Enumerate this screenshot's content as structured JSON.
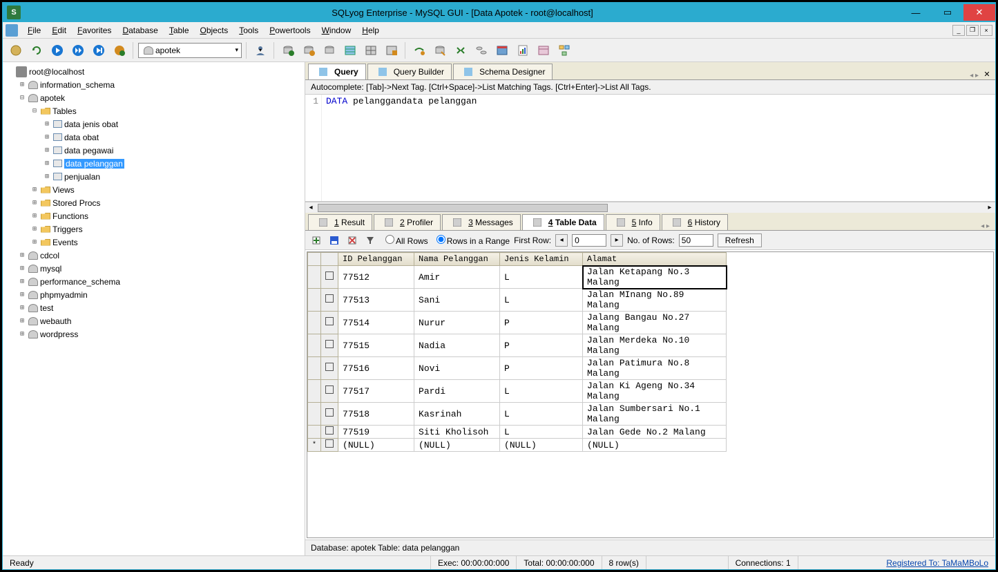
{
  "title": "SQLyog Enterprise - MySQL GUI - [Data Apotek - root@localhost]",
  "menubar": [
    "File",
    "Edit",
    "Favorites",
    "Database",
    "Table",
    "Objects",
    "Tools",
    "Powertools",
    "Window",
    "Help"
  ],
  "db_selected": "apotek",
  "tree": {
    "root": "root@localhost",
    "dbs": [
      {
        "name": "information_schema",
        "expanded": false
      },
      {
        "name": "apotek",
        "expanded": true,
        "children": [
          {
            "name": "Tables",
            "type": "folder",
            "expanded": true,
            "children": [
              {
                "name": "data jenis obat",
                "type": "table"
              },
              {
                "name": "data obat",
                "type": "table"
              },
              {
                "name": "data pegawai",
                "type": "table"
              },
              {
                "name": "data pelanggan",
                "type": "table",
                "selected": true
              },
              {
                "name": "penjualan",
                "type": "table"
              }
            ]
          },
          {
            "name": "Views",
            "type": "folder"
          },
          {
            "name": "Stored Procs",
            "type": "folder"
          },
          {
            "name": "Functions",
            "type": "folder"
          },
          {
            "name": "Triggers",
            "type": "folder"
          },
          {
            "name": "Events",
            "type": "folder"
          }
        ]
      },
      {
        "name": "cdcol"
      },
      {
        "name": "mysql"
      },
      {
        "name": "performance_schema"
      },
      {
        "name": "phpmyadmin"
      },
      {
        "name": "test"
      },
      {
        "name": "webauth"
      },
      {
        "name": "wordpress"
      }
    ]
  },
  "query_tabs": [
    {
      "label": "Query",
      "active": true
    },
    {
      "label": "Query Builder"
    },
    {
      "label": "Schema Designer"
    }
  ],
  "autocomplete_hint": "Autocomplete: [Tab]->Next Tag. [Ctrl+Space]->List Matching Tags. [Ctrl+Enter]->List All Tags.",
  "query": {
    "line": "1",
    "kw": "DATA",
    "rest": " pelanggandata pelanggan"
  },
  "result_tabs": [
    {
      "n": "1",
      "label": "Result"
    },
    {
      "n": "2",
      "label": "Profiler"
    },
    {
      "n": "3",
      "label": "Messages"
    },
    {
      "n": "4",
      "label": "Table Data",
      "active": true
    },
    {
      "n": "5",
      "label": "Info"
    },
    {
      "n": "6",
      "label": "History"
    }
  ],
  "td_toolbar": {
    "allrows": "All Rows",
    "range": "Rows in a Range",
    "firstrow_lbl": "First Row:",
    "firstrow": "0",
    "numrows_lbl": "No. of Rows:",
    "numrows": "50",
    "refresh": "Refresh"
  },
  "columns": [
    "ID Pelanggan",
    "Nama Pelanggan",
    "Jenis Kelamin",
    "Alamat"
  ],
  "rows": [
    [
      "77512",
      "Amir",
      "L",
      "Jalan Ketapang No.3 Malang"
    ],
    [
      "77513",
      "Sani",
      "L",
      "Jalan MInang No.89 Malang"
    ],
    [
      "77514",
      "Nurur",
      "P",
      "Jalang Bangau No.27 Malang"
    ],
    [
      "77515",
      "Nadia",
      "P",
      "Jalan Merdeka No.10 Malang"
    ],
    [
      "77516",
      "Novi",
      "P",
      "Jalan Patimura No.8 Malang"
    ],
    [
      "77517",
      "Pardi",
      "L",
      "Jalan Ki Ageng No.34 Malang"
    ],
    [
      "77518",
      "Kasrinah",
      "L",
      "Jalan Sumbersari No.1 Malang"
    ],
    [
      "77519",
      "Siti Kholisoh",
      "L",
      "Jalan Gede No.2 Malang"
    ]
  ],
  "null_row": [
    "(NULL)",
    "(NULL)",
    "(NULL)",
    "(NULL)"
  ],
  "selected_cell": {
    "row": 0,
    "col": 3
  },
  "dbinfo": "Database: apotek Table: data pelanggan",
  "status": {
    "ready": "Ready",
    "exec": "Exec: 00:00:00:000",
    "total": "Total: 00:00:00:000",
    "rows": "8 row(s)",
    "conn": "Connections: 1",
    "reg": "Registered To: TaMaMBoLo"
  }
}
